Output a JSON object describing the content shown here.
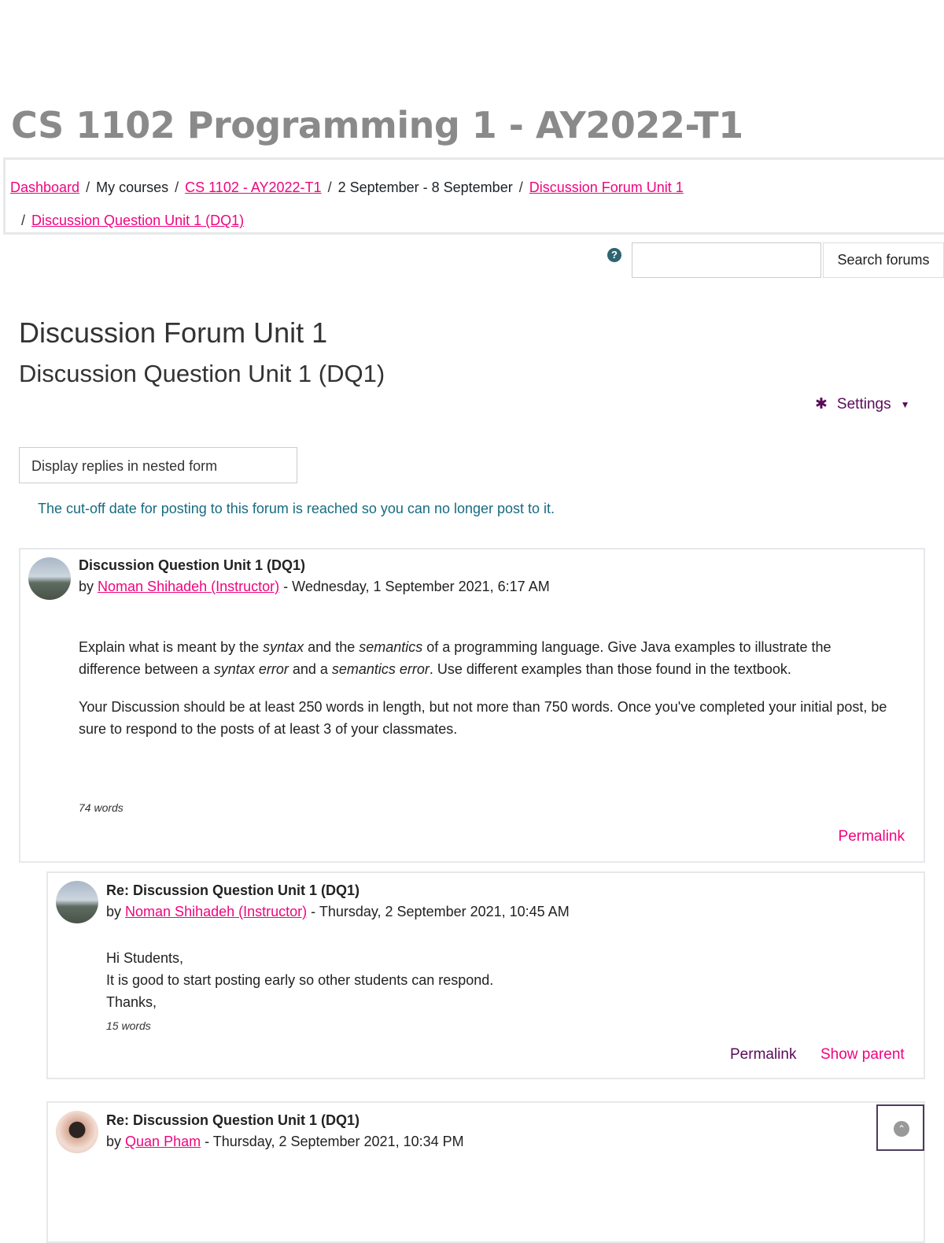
{
  "page_title": "CS 1102 Programming 1 - AY2022-T1",
  "breadcrumb": {
    "dashboard": "Dashboard",
    "my_courses": "My courses",
    "course": "CS 1102 - AY2022-T1",
    "week": "2 September - 8 September",
    "forum": "Discussion Forum Unit 1",
    "discussion": "Discussion Question Unit 1 (DQ1)",
    "sep": "/"
  },
  "search": {
    "help": "?",
    "placeholder": "",
    "button": "Search forums"
  },
  "forum_title": "Discussion Forum Unit 1",
  "discussion_title": "Discussion Question Unit 1 (DQ1)",
  "settings": {
    "label": "Settings",
    "icon": "gear-icon"
  },
  "display_mode": "Display replies in nested form",
  "notice": "The cut-off date for posting to this forum is reached so you can no longer post to it.",
  "posts": [
    {
      "title": "Discussion Question Unit 1 (DQ1)",
      "by": "by",
      "author": "Noman Shihadeh (Instructor)",
      "date": "- Wednesday, 1 September 2021, 6:17 AM",
      "p1a": "Explain what is meant by the ",
      "p1b": "syntax",
      "p1c": " and the ",
      "p1d": "semantics",
      "p1e": " of a programming language. Give Java examples to illustrate the difference between a ",
      "p1f": "syntax error",
      "p1g": " and a ",
      "p1h": "semantics error",
      "p1i": ". Use different examples than those found in the textbook.",
      "p2": "Your Discussion should be at least 250 words in length, but not more than 750 words. Once you've completed your initial post, be sure to respond to the posts of at least 3 of your classmates.",
      "words": "74 words",
      "permalink": "Permalink"
    },
    {
      "title": "Re: Discussion Question Unit 1 (DQ1)",
      "by": "by",
      "author": "Noman Shihadeh (Instructor)",
      "date": "- Thursday, 2 September 2021, 10:45 AM",
      "l1": "Hi Students,",
      "l2": "It is good to start posting early so other students can respond.",
      "l3": "Thanks,",
      "words": "15 words",
      "permalink": "Permalink",
      "show_parent": "Show parent"
    },
    {
      "title": "Re: Discussion Question Unit 1 (DQ1)",
      "by": "by",
      "author": "Quan Pham",
      "date": "- Thursday, 2 September 2021, 10:34 PM"
    }
  ],
  "colors": {
    "link": "#f0047f",
    "settings": "#5a0b5a",
    "notice": "#166c7f"
  }
}
